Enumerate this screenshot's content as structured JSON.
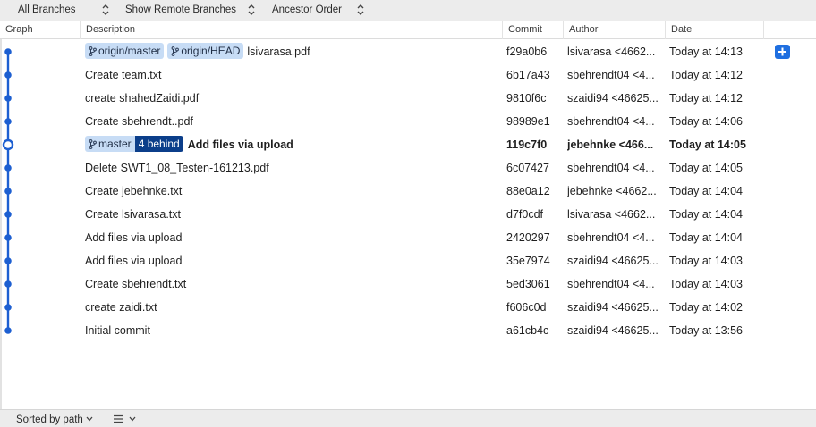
{
  "toolbar": {
    "branches_label": "All Branches",
    "remote_label": "Show Remote Branches",
    "order_label": "Ancestor Order"
  },
  "columns": {
    "graph": "Graph",
    "description": "Description",
    "commit": "Commit",
    "author": "Author",
    "date": "Date"
  },
  "rows": [
    {
      "tags": [
        "origin/master",
        "origin/HEAD"
      ],
      "description": "lsivarasa.pdf",
      "commit": "f29a0b6",
      "author": "lsivarasa <4662...",
      "date": "Today at 14:13"
    },
    {
      "description": "Create team.txt",
      "commit": "6b17a43",
      "author": "sbehrendt04 <4...",
      "date": "Today at 14:12"
    },
    {
      "description": "create shahedZaidi.pdf",
      "commit": "9810f6c",
      "author": "szaidi94 <46625...",
      "date": "Today at 14:12"
    },
    {
      "description": "Create sbehrendt..pdf",
      "commit": "98989e1",
      "author": "sbehrendt04 <4...",
      "date": "Today at 14:06"
    },
    {
      "head_branch": "master",
      "behind": "4 behind",
      "description": "Add files via upload",
      "commit": "119c7f0",
      "author": "jebehnke <466...",
      "date": "Today at 14:05"
    },
    {
      "description": "Delete SWT1_08_Testen-161213.pdf",
      "commit": "6c07427",
      "author": "sbehrendt04 <4...",
      "date": "Today at 14:05"
    },
    {
      "description": "Create jebehnke.txt",
      "commit": "88e0a12",
      "author": "jebehnke <4662...",
      "date": "Today at 14:04"
    },
    {
      "description": "Create lsivarasa.txt",
      "commit": "d7f0cdf",
      "author": "lsivarasa <4662...",
      "date": "Today at 14:04"
    },
    {
      "description": "Add files via upload",
      "commit": "2420297",
      "author": "sbehrendt04 <4...",
      "date": "Today at 14:04"
    },
    {
      "description": "Add files via upload",
      "commit": "35e7974",
      "author": "szaidi94 <46625...",
      "date": "Today at 14:03"
    },
    {
      "description": "Create sbehrendt.txt",
      "commit": "5ed3061",
      "author": "sbehrendt04 <4...",
      "date": "Today at 14:03"
    },
    {
      "description": "create zaidi.txt",
      "commit": "f606c0d",
      "author": "szaidi94 <46625...",
      "date": "Today at 14:02"
    },
    {
      "description": "Initial commit",
      "commit": "a61cb4c",
      "author": "szaidi94 <46625...",
      "date": "Today at 13:56"
    }
  ],
  "footer": {
    "sort_label": "Sorted by path"
  },
  "icons": {
    "add": "plus-icon",
    "branch": "branch-icon",
    "stepper": "up-down-chevron-icon",
    "list": "list-icon"
  },
  "colors": {
    "accent": "#1f6fe0",
    "graph_line": "#1d5fd1",
    "tag_bg": "#c7dcf5",
    "behind_bg": "#0b3e8a"
  }
}
